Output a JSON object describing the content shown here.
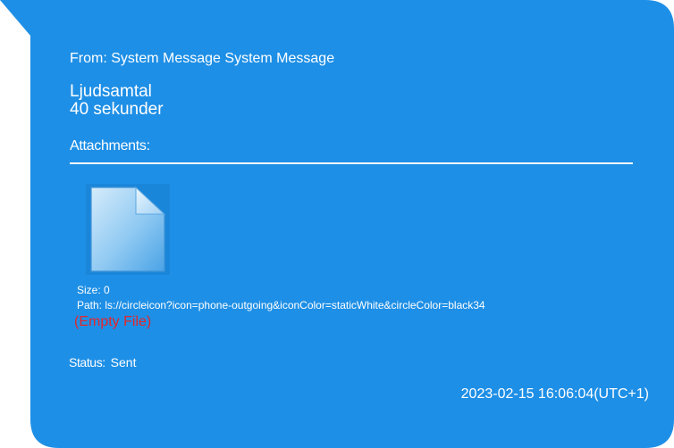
{
  "colors": {
    "bubble_background": "#1e8fe6",
    "text": "#ffffff",
    "empty_file_text": "#e3262b"
  },
  "message": {
    "from_label": "From:",
    "from_value": "System Message System Message",
    "lines": [
      "Ljudsamtal",
      "40 sekunder"
    ]
  },
  "attachments": {
    "heading": "Attachments:",
    "items": [
      {
        "icon": "file-icon",
        "size_label": "Size:",
        "size_value": "0",
        "path_label": "Path:",
        "path_value": "ls://circleicon?icon=phone-outgoing&iconColor=staticWhite&circleColor=black34",
        "empty_note": "(Empty File)"
      }
    ]
  },
  "status": {
    "label": "Status:",
    "value": "Sent"
  },
  "timestamp": "2023-02-15 16:06:04(UTC+1)"
}
